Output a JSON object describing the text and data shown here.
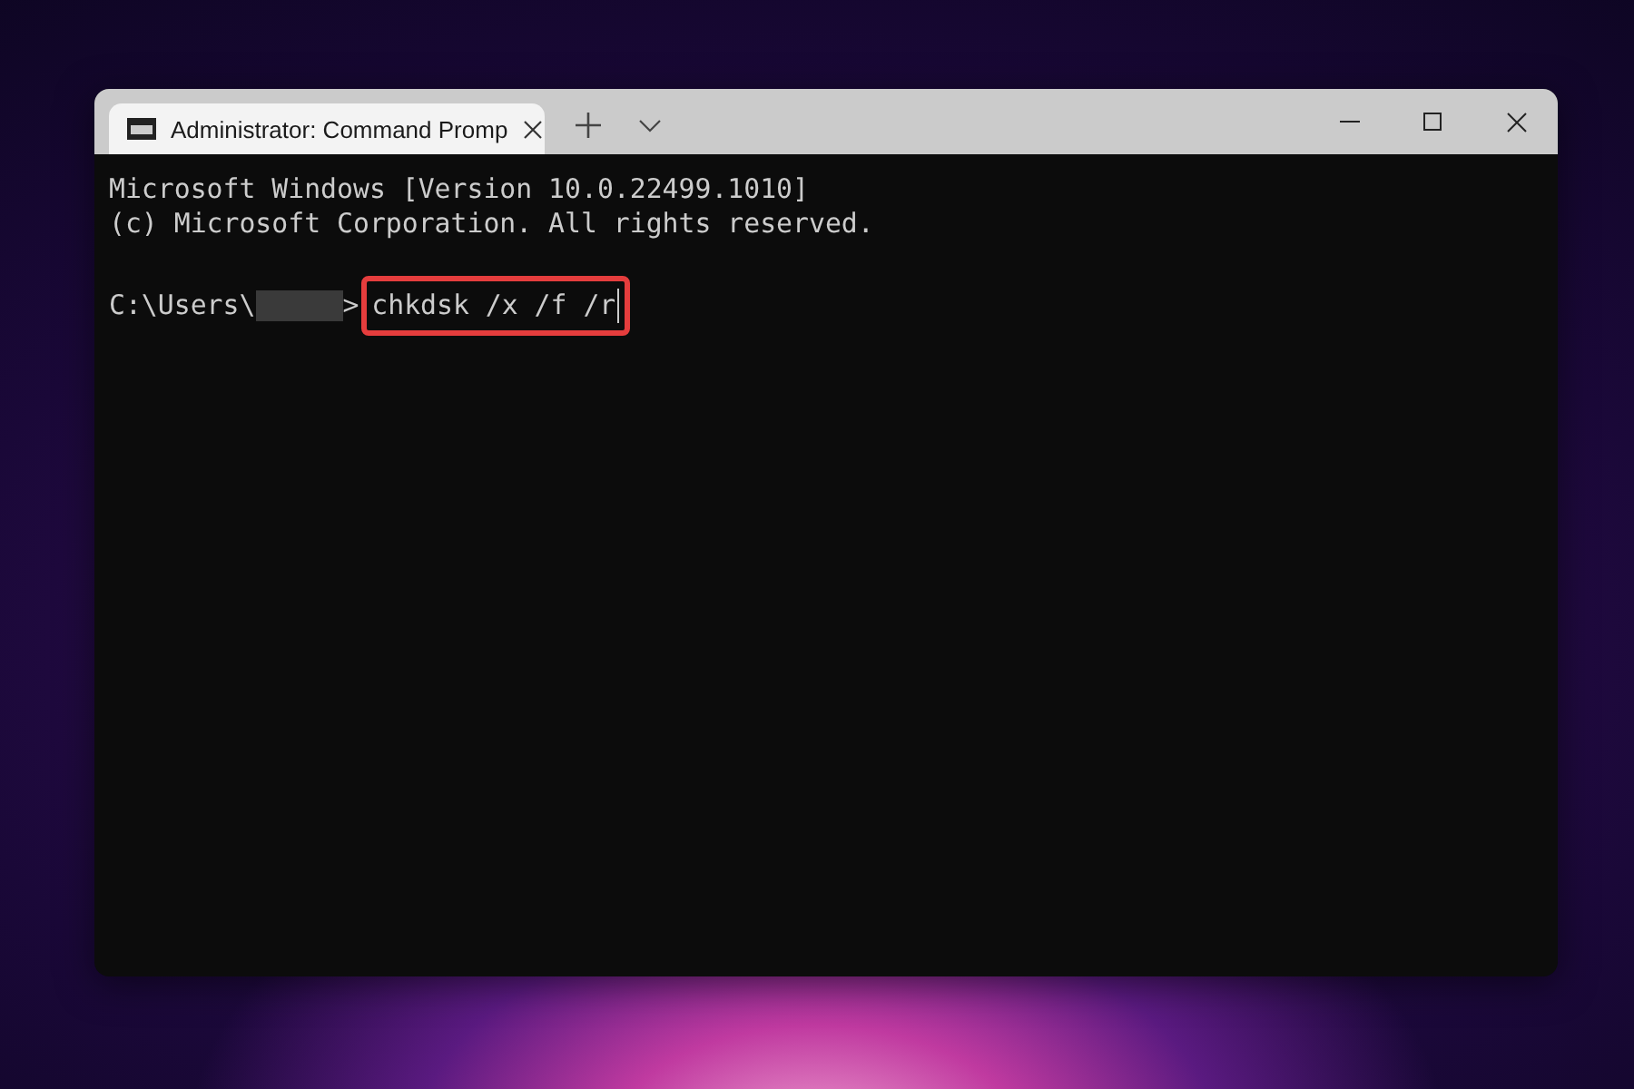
{
  "window": {
    "tab_title": "Administrator: Command Promp"
  },
  "console": {
    "lines": [
      "Microsoft Windows [Version 10.0.22499.1010]",
      "(c) Microsoft Corporation. All rights reserved."
    ],
    "prompt": {
      "path": "C:\\Users\\",
      "redacted": true,
      "separator": ">",
      "command": "chkdsk /x /f /r",
      "highlighted": true
    }
  }
}
